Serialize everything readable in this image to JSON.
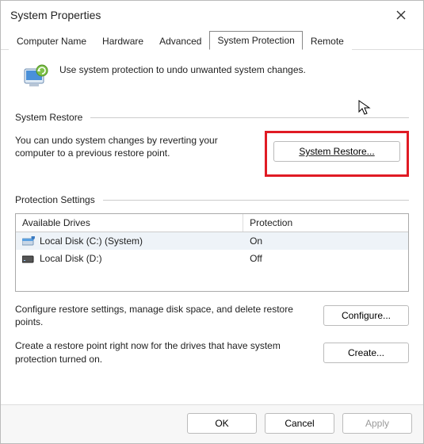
{
  "window": {
    "title": "System Properties"
  },
  "tabs": {
    "items": [
      {
        "label": "Computer Name"
      },
      {
        "label": "Hardware"
      },
      {
        "label": "Advanced"
      },
      {
        "label": "System Protection"
      },
      {
        "label": "Remote"
      }
    ],
    "active_index": 3
  },
  "intro": {
    "text": "Use system protection to undo unwanted system changes."
  },
  "restore_section": {
    "heading": "System Restore",
    "description": "You can undo system changes by reverting your computer to a previous restore point.",
    "button_label": "System Restore..."
  },
  "protection_section": {
    "heading": "Protection Settings",
    "columns": {
      "drive": "Available Drives",
      "protection": "Protection"
    },
    "drives": [
      {
        "name": "Local Disk (C:) (System)",
        "protection": "On",
        "icon": "drive-shield-icon"
      },
      {
        "name": "Local Disk (D:)",
        "protection": "Off",
        "icon": "drive-icon"
      }
    ],
    "configure": {
      "description": "Configure restore settings, manage disk space, and delete restore points.",
      "button_label": "Configure..."
    },
    "create": {
      "description": "Create a restore point right now for the drives that have system protection turned on.",
      "button_label": "Create..."
    }
  },
  "footer": {
    "ok": "OK",
    "cancel": "Cancel",
    "apply": "Apply"
  }
}
